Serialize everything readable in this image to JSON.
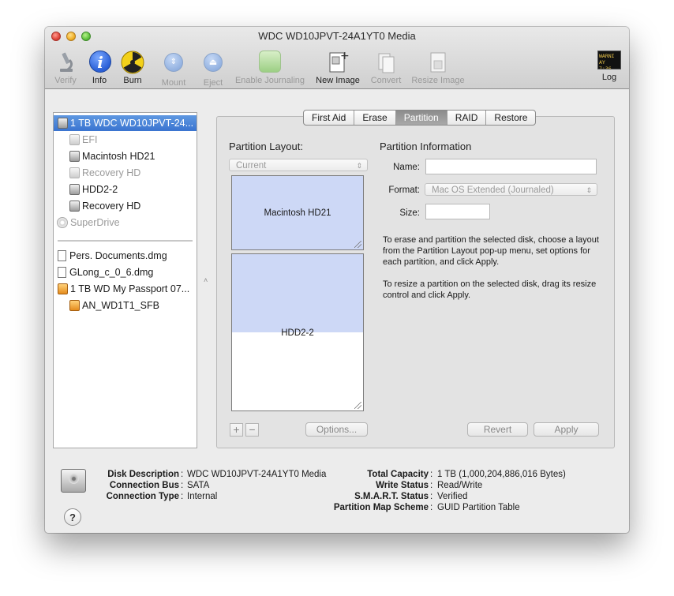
{
  "window": {
    "title": "WDC WD10JPVT-24A1YT0 Media"
  },
  "toolbar": {
    "items": [
      {
        "label": "Verify",
        "icon": "microscope-icon",
        "enabled": false
      },
      {
        "label": "Info",
        "icon": "info-icon",
        "enabled": true
      },
      {
        "label": "Burn",
        "icon": "burn-radiation-icon",
        "enabled": true
      },
      {
        "label": "Mount",
        "icon": "mount-icon",
        "enabled": false
      },
      {
        "label": "Eject",
        "icon": "eject-icon",
        "enabled": false
      },
      {
        "label": "Enable Journaling",
        "icon": "journaling-icon",
        "enabled": false
      },
      {
        "label": "New Image",
        "icon": "new-image-icon",
        "enabled": true
      },
      {
        "label": "Convert",
        "icon": "convert-icon",
        "enabled": false
      },
      {
        "label": "Resize Image",
        "icon": "resize-image-icon",
        "enabled": false
      },
      {
        "label": "Log",
        "icon": "log-console-icon",
        "enabled": true,
        "icon_text": "WARNI\nAY 7:36"
      }
    ]
  },
  "sidebar": {
    "items": [
      {
        "label": "1 TB WDC WD10JPVT-24...",
        "type": "disk",
        "selected": true
      },
      {
        "label": "EFI",
        "type": "volume",
        "dimmed": true
      },
      {
        "label": "Macintosh HD21",
        "type": "volume"
      },
      {
        "label": "Recovery HD",
        "type": "volume",
        "dimmed": true
      },
      {
        "label": "HDD2-2",
        "type": "volume"
      },
      {
        "label": "Recovery HD",
        "type": "volume"
      },
      {
        "label": "SuperDrive",
        "type": "optical",
        "dimmed": true
      },
      {
        "label": "Pers. Documents.dmg",
        "type": "image"
      },
      {
        "label": "GLong_c_0_6.dmg",
        "type": "image"
      },
      {
        "label": "1 TB WD My Passport 07...",
        "type": "external-disk"
      },
      {
        "label": "AN_WD1T1_SFB",
        "type": "external-volume"
      }
    ]
  },
  "tabs": [
    {
      "label": "First Aid",
      "active": false
    },
    {
      "label": "Erase",
      "active": false
    },
    {
      "label": "Partition",
      "active": true
    },
    {
      "label": "RAID",
      "active": false
    },
    {
      "label": "Restore",
      "active": false
    }
  ],
  "partition": {
    "layout_title": "Partition Layout:",
    "layout_value": "Current",
    "partitions": [
      {
        "name": "Macintosh HD21",
        "used_fraction": 1.0
      },
      {
        "name": "HDD2-2",
        "used_fraction": 0.5
      }
    ],
    "add_label": "+",
    "remove_label": "−",
    "options_label": "Options...",
    "revert_label": "Revert",
    "apply_label": "Apply"
  },
  "info": {
    "title": "Partition Information",
    "name_label": "Name:",
    "name_value": "",
    "format_label": "Format:",
    "format_value": "Mac OS Extended (Journaled)",
    "size_label": "Size:",
    "size_value": "",
    "help1": "To erase and partition the selected disk, choose a layout from the Partition Layout pop-up menu, set options for each partition, and click Apply.",
    "help2": "To resize a partition on the selected disk, drag its resize control and click Apply."
  },
  "details": {
    "left": [
      {
        "label": "Disk Description",
        "value": "WDC WD10JPVT-24A1YT0 Media"
      },
      {
        "label": "Connection Bus",
        "value": "SATA"
      },
      {
        "label": "Connection Type",
        "value": "Internal"
      }
    ],
    "right": [
      {
        "label": "Total Capacity",
        "value": "1 TB (1,000,204,886,016 Bytes)"
      },
      {
        "label": "Write Status",
        "value": "Read/Write"
      },
      {
        "label": "S.M.A.R.T. Status",
        "value": "Verified"
      },
      {
        "label": "Partition Map Scheme",
        "value": "GUID Partition Table"
      }
    ],
    "separator": ":",
    "help_label": "?"
  }
}
